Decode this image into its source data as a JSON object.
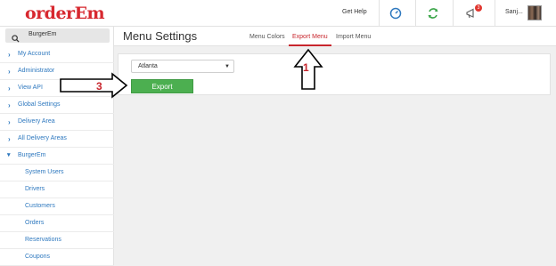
{
  "header": {
    "logo_text": "orderEm",
    "help_label": "Get Help",
    "notifications_count": "3",
    "user_name": "Sanj...",
    "icons": [
      "speedometer-icon",
      "refresh-icon",
      "megaphone-icon"
    ],
    "colors": {
      "brand_red": "#d7282f",
      "dashboard_blue": "#2f79bf",
      "refresh_green": "#3aa548"
    }
  },
  "sidebar": {
    "search_value": "BurgerEm",
    "items": [
      {
        "label": "My Account"
      },
      {
        "label": "Administrator"
      },
      {
        "label": "View API"
      },
      {
        "label": "Global Settings"
      },
      {
        "label": "Delivery Area"
      },
      {
        "label": "All Delivery Areas"
      },
      {
        "label": "BurgerEm",
        "expanded": true
      }
    ],
    "subitems": [
      {
        "label": "System Users"
      },
      {
        "label": "Drivers"
      },
      {
        "label": "Customers"
      },
      {
        "label": "Orders"
      },
      {
        "label": "Reservations"
      },
      {
        "label": "Coupons"
      }
    ]
  },
  "main": {
    "title": "Menu Settings",
    "tabs": [
      {
        "label": "Menu Colors",
        "active": false
      },
      {
        "label": "Export Menu",
        "active": true
      },
      {
        "label": "Import Menu",
        "active": false
      }
    ],
    "location_select": {
      "value": "Atlanta"
    },
    "export_button": "Export"
  },
  "annotations": {
    "marker_1": "1",
    "marker_3": "3",
    "color": "#c8262d"
  }
}
